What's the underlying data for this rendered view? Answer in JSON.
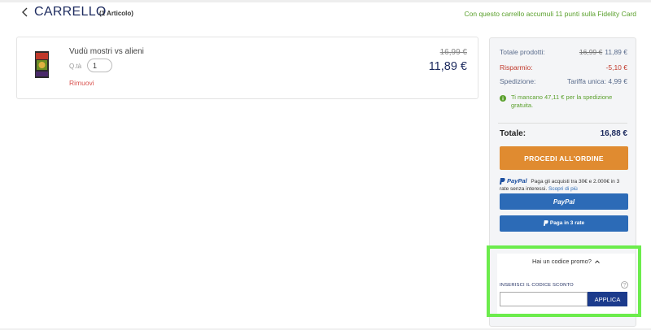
{
  "header": {
    "title": "CARRELLO",
    "count": "(1 Articolo)",
    "fidelity_note": "Con questo carrello accumuli 11 punti sulla Fidelity Card"
  },
  "cart_item": {
    "name": "Vudù mostri vs alieni",
    "qty_label": "Q.tà",
    "qty_value": "1",
    "remove_label": "Rimuovi",
    "old_price": "16,99 €",
    "new_price": "11,89 €"
  },
  "summary": {
    "products_label": "Totale prodotti:",
    "products_old": "16,99 €",
    "products_new": "11,89 €",
    "savings_label": "Risparmio:",
    "savings_value": "-5,10 €",
    "shipping_label": "Spedizione:",
    "shipping_value": "Tariffa unica: 4,99 €",
    "free_shipping_note": "Ti mancano 47,11 € per la spedizione gratuita.",
    "total_label": "Totale:",
    "total_value": "16,88 €",
    "order_button": "PROCEDI ALL'ORDINE",
    "paypal_brand": "PayPal",
    "paypal_info": "Paga gli acquisti tra 30€ e 2.000€ in 3 rate senza interessi.",
    "paypal_link": "Scopri di più",
    "paypal_button": "PayPal",
    "paypal_3_button": "Paga in 3 rate"
  },
  "promo": {
    "toggle_label": "Hai un codice promo?",
    "input_label": "INSERISCI IL CODICE SCONTO",
    "input_value": "",
    "apply_button": "APPLICA"
  },
  "colors": {
    "brand_navy": "#1c2a5e",
    "order_orange": "#e08b30",
    "paypal_blue": "#2c6bb7",
    "fidelity_green": "#5aa02c",
    "savings_red": "#c0392b",
    "highlight_green": "#6cec4c"
  }
}
